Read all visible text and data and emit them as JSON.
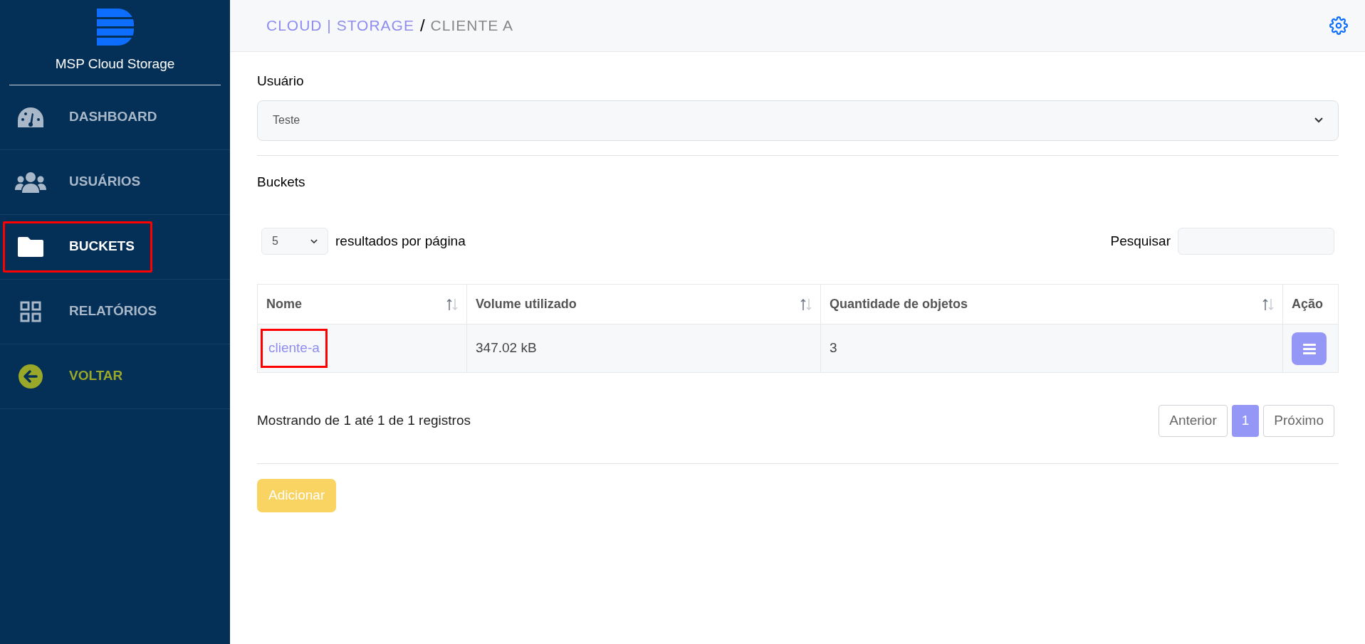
{
  "sidebar": {
    "brand": "MSP Cloud Storage",
    "items": [
      {
        "kind": "gauge",
        "label": "DASHBOARD",
        "selected": false,
        "highlighted": false
      },
      {
        "kind": "users",
        "label": "USUÁRIOS",
        "selected": false,
        "highlighted": false
      },
      {
        "kind": "folder",
        "label": "BUCKETS",
        "selected": true,
        "highlighted": true
      },
      {
        "kind": "grid",
        "label": "RELATÓRIOS",
        "selected": false,
        "highlighted": false
      },
      {
        "kind": "back",
        "label": "VOLTAR",
        "selected": false,
        "highlighted": false
      }
    ]
  },
  "header": {
    "breadcrumb_root": "CLOUD | STORAGE",
    "separator": "/",
    "breadcrumb_current": "CLIENTE A"
  },
  "user_select": {
    "label": "Usuário",
    "value": "Teste"
  },
  "buckets": {
    "title": "Buckets",
    "page_size": "5",
    "page_size_label": "resultados por página",
    "search_label": "Pesquisar",
    "table": {
      "columns": [
        {
          "label": "Nome",
          "sortable": true
        },
        {
          "label": "Volume utilizado",
          "sortable": true
        },
        {
          "label": "Quantidade de objetos",
          "sortable": true
        },
        {
          "label": "Ação",
          "sortable": false
        }
      ],
      "rows": [
        {
          "name": "cliente-a",
          "name_highlighted": true,
          "volume": "347.02 kB",
          "objects": "3"
        }
      ]
    },
    "info": "Mostrando de 1 até 1 de 1 registros",
    "pagination": [
      {
        "label": "Anterior",
        "selected": false
      },
      {
        "label": "1",
        "selected": true
      },
      {
        "label": "Próximo",
        "selected": false
      }
    ],
    "add_button": "Adicionar"
  }
}
